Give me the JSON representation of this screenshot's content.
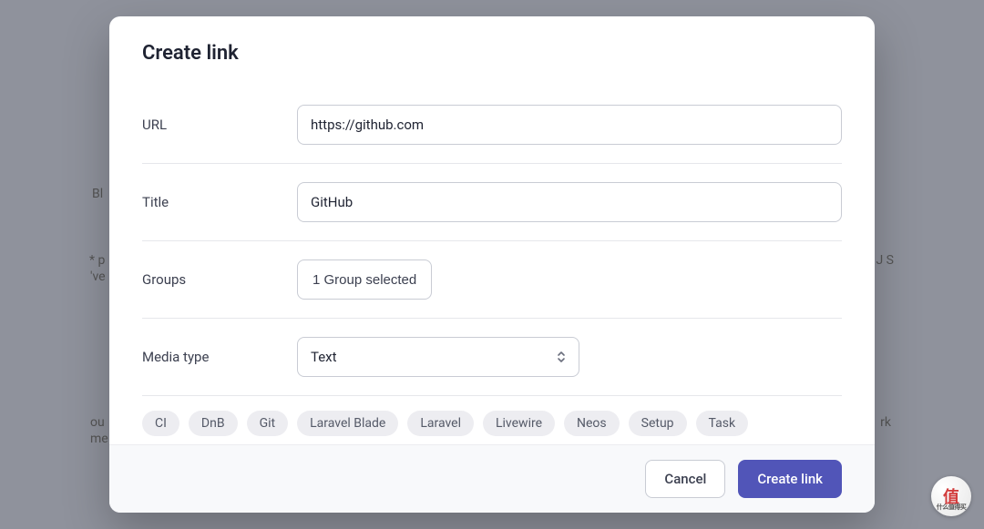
{
  "modal": {
    "title": "Create link",
    "fields": {
      "url": {
        "label": "URL",
        "value": "https://github.com"
      },
      "title": {
        "label": "Title",
        "value": "GitHub"
      },
      "groups": {
        "label": "Groups",
        "button_text": "1 Group selected"
      },
      "media_type": {
        "label": "Media type",
        "selected": "Text"
      }
    },
    "tags": [
      "CI",
      "DnB",
      "Git",
      "Laravel Blade",
      "Laravel",
      "Livewire",
      "Neos",
      "Setup",
      "Task"
    ],
    "footer": {
      "cancel": "Cancel",
      "submit": "Create link"
    }
  },
  "background": {
    "left1": "Bl",
    "left2": "* p",
    "left3": "'ve",
    "left4": "ou",
    "left5": "me",
    "right1": "J S",
    "right2": "rk"
  },
  "watermark": {
    "main": "值",
    "sub": "什么值得买"
  }
}
